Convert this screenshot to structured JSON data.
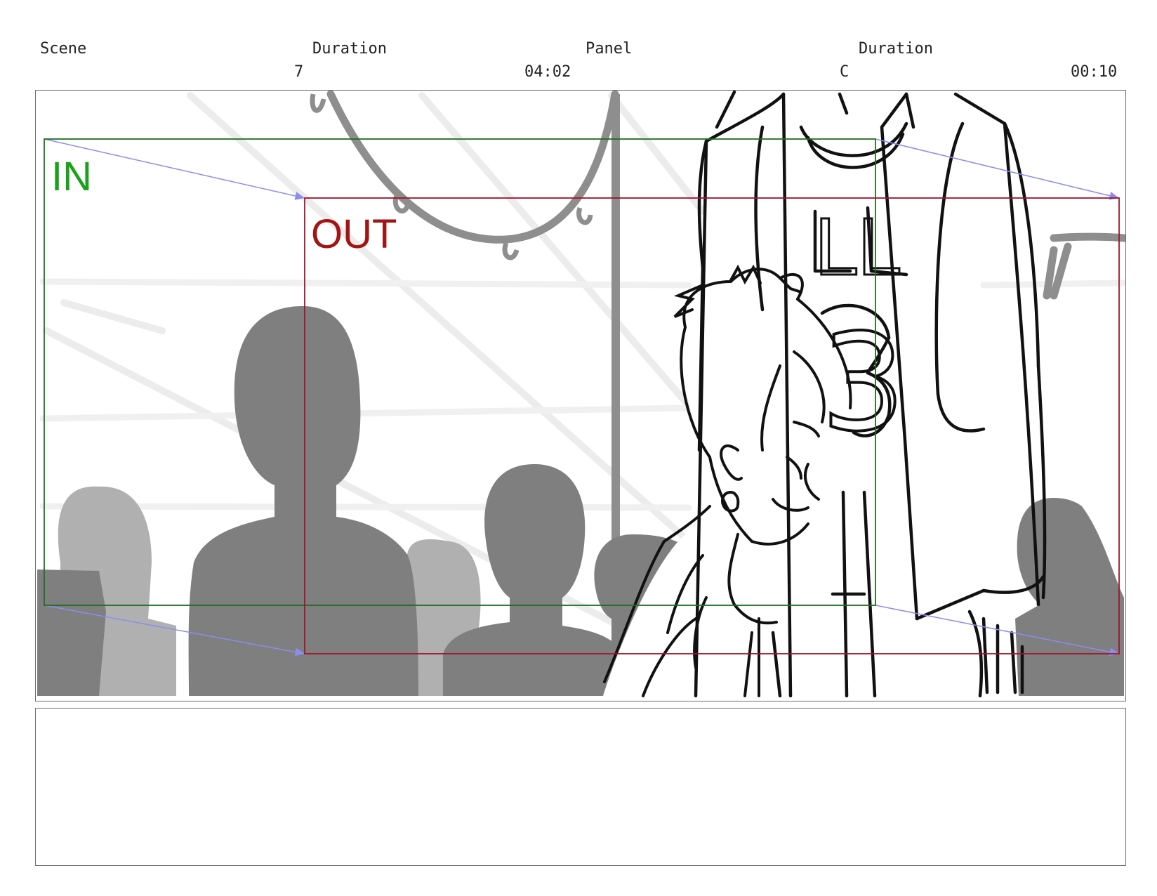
{
  "header": {
    "scene_label": "Scene",
    "scene_duration_label": "Duration",
    "panel_label": "Panel",
    "panel_duration_label": "Duration",
    "scene_value": "7",
    "scene_duration_value": "04:02",
    "panel_value": "C",
    "panel_duration_value": "00:10"
  },
  "frames": {
    "in_label": "IN",
    "out_label": "OUT",
    "in_color": "#1aa31a",
    "out_color": "#a31515",
    "arrow_color": "#8c8cf0"
  },
  "artwork": {
    "jersey_letters": "LL",
    "jersey_number": "3"
  },
  "notes": {
    "text": ""
  }
}
